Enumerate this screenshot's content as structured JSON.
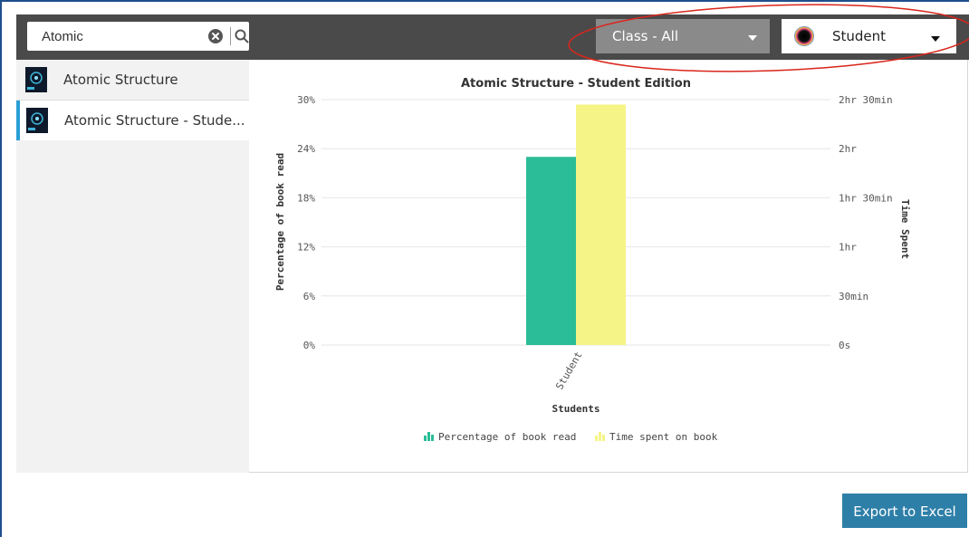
{
  "search": {
    "value": "Atomic"
  },
  "filters": {
    "class_label": "Class - All",
    "student_label": "Student"
  },
  "books": [
    {
      "title": "Atomic Structure"
    },
    {
      "title": "Atomic Structure - Stude..."
    }
  ],
  "chart_data": {
    "type": "bar",
    "title": "Atomic Structure - Student Edition",
    "categories": [
      "Student"
    ],
    "xlabel": "Students",
    "ylabel": "Percentage of book read",
    "y2label": "Time Spent",
    "y_ticks": [
      "0%",
      "6%",
      "12%",
      "18%",
      "24%",
      "30%"
    ],
    "y2_ticks": [
      "0s",
      "30min",
      "1hr",
      "1hr 30min",
      "2hr",
      "2hr 30min"
    ],
    "ylim": [
      0,
      30
    ],
    "y2lim_minutes": [
      0,
      150
    ],
    "series": [
      {
        "name": "Percentage of book read",
        "axis": "left",
        "values": [
          23
        ],
        "color": "#2bbd97"
      },
      {
        "name": "Time spent on book",
        "axis": "right",
        "values_minutes": [
          147
        ],
        "color": "#f5f487"
      }
    ],
    "legend_position": "bottom",
    "grid": true
  },
  "actions": {
    "export_label": "Export to Excel"
  },
  "colors": {
    "toolbar": "#4a4a4a",
    "accent": "#2a9fd6",
    "export": "#2e7fa8",
    "annotation": "#d9261c"
  }
}
